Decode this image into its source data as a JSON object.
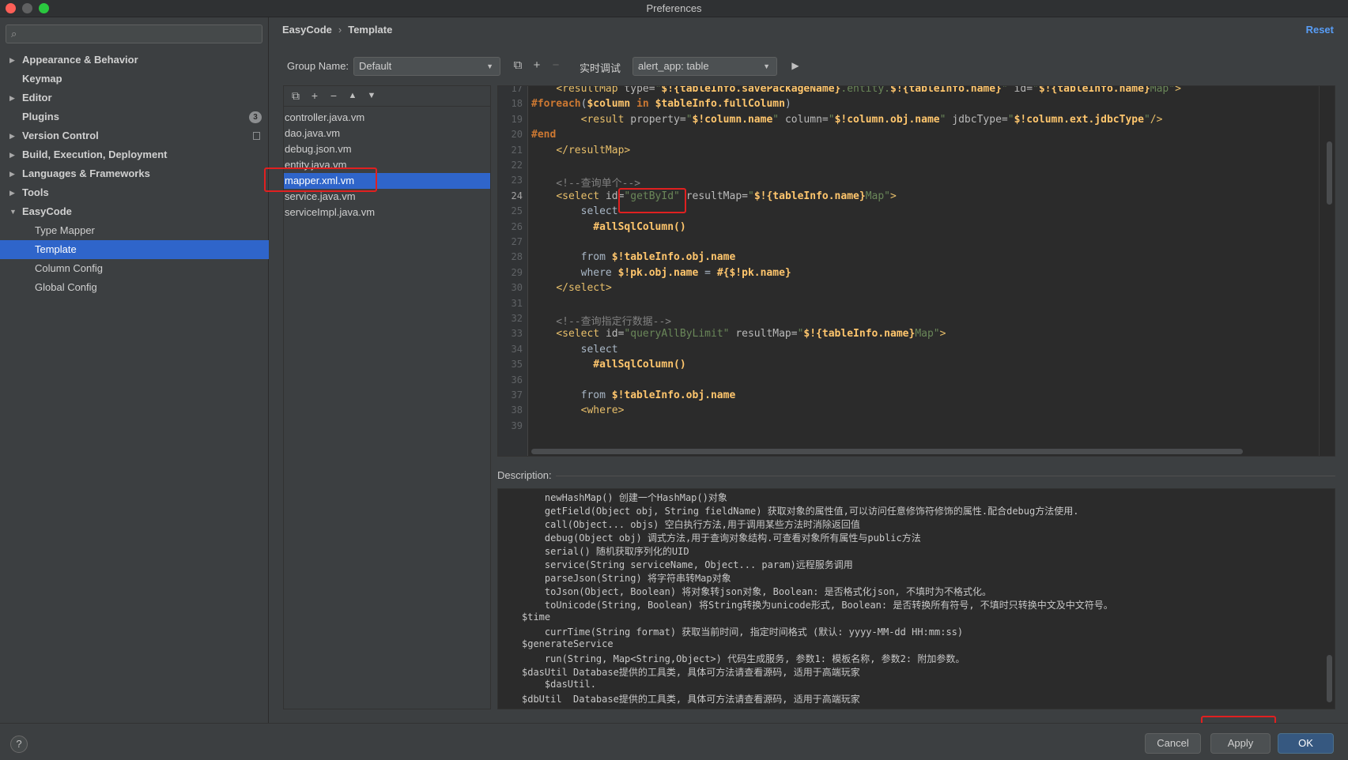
{
  "window": {
    "title": "Preferences"
  },
  "sidebar": {
    "search_placeholder": "",
    "items": [
      {
        "label": "Appearance & Behavior",
        "expandable": true
      },
      {
        "label": "Keymap",
        "expandable": false
      },
      {
        "label": "Editor",
        "expandable": true
      },
      {
        "label": "Plugins",
        "expandable": false,
        "badge": "3"
      },
      {
        "label": "Version Control",
        "expandable": true
      },
      {
        "label": "Build, Execution, Deployment",
        "expandable": true
      },
      {
        "label": "Languages & Frameworks",
        "expandable": true
      },
      {
        "label": "Tools",
        "expandable": true
      },
      {
        "label": "EasyCode",
        "expandable": true,
        "expanded": true
      },
      {
        "label": "Type Mapper",
        "child": true
      },
      {
        "label": "Template",
        "child": true,
        "selected": true
      },
      {
        "label": "Column Config",
        "child": true
      },
      {
        "label": "Global Config",
        "child": true
      }
    ]
  },
  "breadcrumb": {
    "parent": "EasyCode",
    "separator": "›",
    "current": "Template"
  },
  "reset_label": "Reset",
  "toolbar": {
    "group_name_label": "Group Name:",
    "group_name_value": "Default",
    "debug_label": "实时调试",
    "debug_value": "alert_app: table"
  },
  "files": [
    {
      "name": "controller.java.vm"
    },
    {
      "name": "dao.java.vm"
    },
    {
      "name": "debug.json.vm"
    },
    {
      "name": "entity.java.vm"
    },
    {
      "name": "mapper.xml.vm",
      "selected": true
    },
    {
      "name": "service.java.vm"
    },
    {
      "name": "serviceImpl.java.vm"
    }
  ],
  "editor": {
    "current_line": 24,
    "lines": [
      {
        "no": "17",
        "text": "    <resultMap type=\"$!{tableInfo.savePackageName}.entity.$!{tableInfo.name}\" id=\"$!{tableInfo.name}Map\">"
      },
      {
        "no": "18",
        "text": "#foreach($column in $tableInfo.fullColumn)"
      },
      {
        "no": "19",
        "text": "        <result property=\"$!column.name\" column=\"$!column.obj.name\" jdbcType=\"$!column.ext.jdbcType\"/>"
      },
      {
        "no": "20",
        "text": "#end"
      },
      {
        "no": "21",
        "text": "    </resultMap>"
      },
      {
        "no": "22",
        "text": ""
      },
      {
        "no": "23",
        "text": "    <!--查询单个-->"
      },
      {
        "no": "24",
        "text": "    <select id=\"getById\" resultMap=\"$!{tableInfo.name}Map\">"
      },
      {
        "no": "25",
        "text": "        select"
      },
      {
        "no": "26",
        "text": "          #allSqlColumn()"
      },
      {
        "no": "27",
        "text": ""
      },
      {
        "no": "28",
        "text": "        from $!tableInfo.obj.name"
      },
      {
        "no": "29",
        "text": "        where $!pk.obj.name = #{$!pk.name}"
      },
      {
        "no": "30",
        "text": "    </select>"
      },
      {
        "no": "31",
        "text": ""
      },
      {
        "no": "32",
        "text": "    <!--查询指定行数据-->"
      },
      {
        "no": "33",
        "text": "    <select id=\"queryAllByLimit\" resultMap=\"$!{tableInfo.name}Map\">"
      },
      {
        "no": "34",
        "text": "        select"
      },
      {
        "no": "35",
        "text": "          #allSqlColumn()"
      },
      {
        "no": "36",
        "text": ""
      },
      {
        "no": "37",
        "text": "        from $!tableInfo.obj.name"
      },
      {
        "no": "38",
        "text": "        <where>"
      },
      {
        "no": "39",
        "text": ""
      }
    ]
  },
  "description": {
    "label": "Description:",
    "lines": [
      "    newHashMap() 创建一个HashMap()对象",
      "    getField(Object obj, String fieldName) 获取对象的属性值,可以访问任意修饰符修饰的属性.配合debug方法使用.",
      "    call(Object... objs) 空白执行方法,用于调用某些方法时消除返回值",
      "    debug(Object obj) 调式方法,用于查询对象结构.可查看对象所有属性与public方法",
      "    serial() 随机获取序列化的UID",
      "    service(String serviceName, Object... param)远程服务调用",
      "    parseJson(String) 将字符串转Map对象",
      "    toJson(Object, Boolean) 将对象转json对象, Boolean: 是否格式化json, 不填时为不格式化。",
      "    toUnicode(String, Boolean) 将String转换为unicode形式, Boolean: 是否转换所有符号, 不填时只转换中文及中文符号。",
      "$time",
      "    currTime(String format) 获取当前时间, 指定时间格式 (默认: yyyy-MM-dd HH:mm:ss)",
      "$generateService",
      "    run(String, Map<String,Object>) 代码生成服务, 参数1: 模板名称, 参数2: 附加参数。",
      "$dasUtil Database提供的工具类, 具体可方法请查看源码, 适用于高端玩家",
      "    $dasUtil.",
      "$dbUtil  Database提供的工具类, 具体可方法请查看源码, 适用于高端玩家"
    ]
  },
  "buttons": {
    "help": "?",
    "cancel": "Cancel",
    "apply": "Apply",
    "ok": "OK"
  },
  "colors": {
    "selection": "#2f65ca",
    "highlight": "#e02020",
    "primary_button": "#365880"
  }
}
